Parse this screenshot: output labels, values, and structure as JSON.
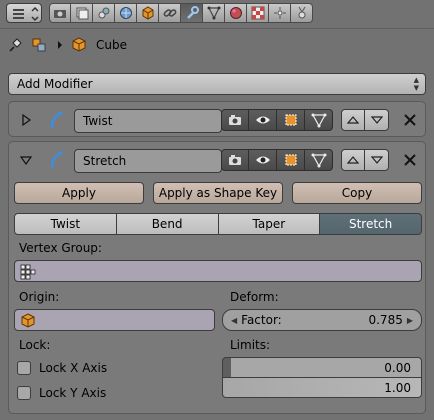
{
  "breadcrumb": {
    "object_name": "Cube"
  },
  "add_modifier": {
    "label": "Add Modifier"
  },
  "modifiers": [
    {
      "name": "Twist"
    },
    {
      "name": "Stretch"
    }
  ],
  "actions": {
    "apply": "Apply",
    "apply_shape": "Apply as Shape Key",
    "copy": "Copy"
  },
  "modes": [
    "Twist",
    "Bend",
    "Taper",
    "Stretch"
  ],
  "selected_mode": "Stretch",
  "vertex_group": {
    "label": "Vertex Group:"
  },
  "origin": {
    "label": "Origin:"
  },
  "deform": {
    "label": "Deform:",
    "factor_label": "Factor:",
    "factor_value": "0.785"
  },
  "lock": {
    "label": "Lock:",
    "x_axis": "Lock X Axis",
    "y_axis": "Lock Y Axis"
  },
  "limits": {
    "label": "Limits:",
    "min": "0.00",
    "max": "1.00"
  },
  "colors": {
    "selected_tab": "#5e6f78",
    "action_button": "#c8b7aa",
    "background": "#727272"
  }
}
